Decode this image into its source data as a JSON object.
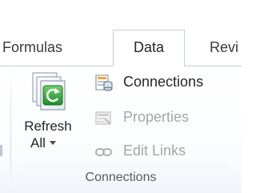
{
  "tabs": {
    "formulas": "Formulas",
    "data": "Data",
    "review": "Revi"
  },
  "group": {
    "caption": "Connections",
    "refresh": {
      "line1": "Refresh",
      "line2": "All"
    },
    "buttons": {
      "connections": "Connections",
      "properties": "Properties",
      "edit_links": "Edit Links"
    }
  },
  "icons": {
    "refresh": "refresh-all-icon",
    "connections": "connections-icon",
    "properties": "properties-icon",
    "edit_links": "edit-links-icon"
  },
  "colors": {
    "tab_border": "#c5cfdc",
    "disabled_text": "#a6a6a6",
    "refresh_green": "#2f9a3a"
  }
}
